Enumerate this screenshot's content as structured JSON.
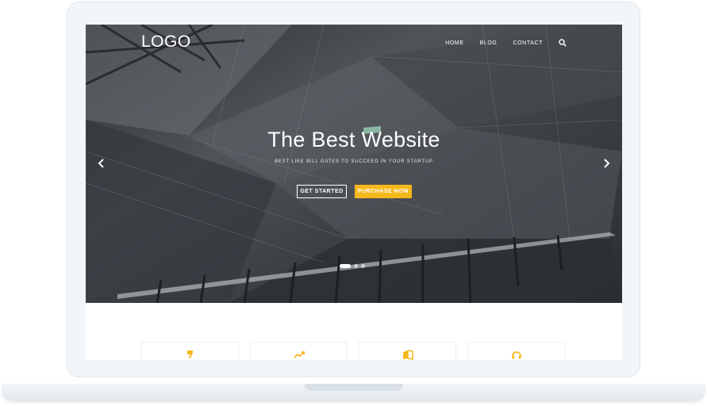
{
  "brand": {
    "logo": "LOGO"
  },
  "nav": {
    "items": [
      "HOME",
      "BLOG",
      "CONTACT"
    ],
    "search_icon": "search-icon"
  },
  "hero": {
    "title": "The Best Website",
    "subtitle": "BEST LIKE BILL GATES TO SUCCEED IN YOUR STARTUP",
    "primary_button": "GET STARTED",
    "secondary_button": "PURCHASE NOW",
    "slides": {
      "count": 3,
      "active": 1
    }
  },
  "features": [
    {
      "icon": "pencil-icon"
    },
    {
      "icon": "trend-up-icon"
    },
    {
      "icon": "book-icon"
    },
    {
      "icon": "headset-icon"
    }
  ],
  "colors": {
    "accent": "#f5b81b",
    "hero_text": "#ffffff"
  }
}
